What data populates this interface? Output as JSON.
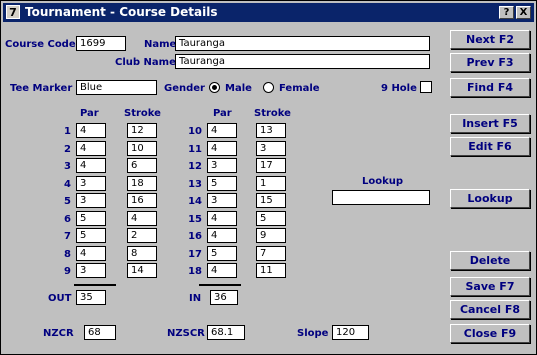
{
  "window": {
    "title": "Tournament - Course Details",
    "icon_glyph": "7",
    "help_glyph": "?",
    "close_glyph": "X"
  },
  "course": {
    "code_label": "Course Code",
    "code": "1699",
    "name_label": "Name",
    "name": "Tauranga",
    "club_label": "Club Name",
    "club": "Tauranga",
    "tee_label": "Tee Marker",
    "tee": "Blue",
    "gender_label": "Gender",
    "male_label": "Male",
    "female_label": "Female",
    "gender_selected": "Male",
    "nine_hole_label": "9 Hole",
    "nine_hole_checked": false
  },
  "holes": {
    "par_header": "Par",
    "stroke_header": "Stroke",
    "front": [
      {
        "n": "1",
        "par": "4",
        "stroke": "12"
      },
      {
        "n": "2",
        "par": "4",
        "stroke": "10"
      },
      {
        "n": "3",
        "par": "4",
        "stroke": "6"
      },
      {
        "n": "4",
        "par": "3",
        "stroke": "18"
      },
      {
        "n": "5",
        "par": "3",
        "stroke": "16"
      },
      {
        "n": "6",
        "par": "5",
        "stroke": "4"
      },
      {
        "n": "7",
        "par": "5",
        "stroke": "2"
      },
      {
        "n": "8",
        "par": "4",
        "stroke": "8"
      },
      {
        "n": "9",
        "par": "3",
        "stroke": "14"
      }
    ],
    "back": [
      {
        "n": "10",
        "par": "4",
        "stroke": "13"
      },
      {
        "n": "11",
        "par": "4",
        "stroke": "3"
      },
      {
        "n": "12",
        "par": "3",
        "stroke": "17"
      },
      {
        "n": "13",
        "par": "5",
        "stroke": "1"
      },
      {
        "n": "14",
        "par": "3",
        "stroke": "15"
      },
      {
        "n": "15",
        "par": "4",
        "stroke": "5"
      },
      {
        "n": "16",
        "par": "4",
        "stroke": "9"
      },
      {
        "n": "17",
        "par": "5",
        "stroke": "7"
      },
      {
        "n": "18",
        "par": "4",
        "stroke": "11"
      }
    ],
    "out_label": "OUT",
    "out": "35",
    "in_label": "IN",
    "in": "36"
  },
  "ratings": {
    "nzcr_label": "NZCR",
    "nzcr": "68",
    "nzscr_label": "NZSCR",
    "nzscr": "68.1",
    "slope_label": "Slope",
    "slope": "120"
  },
  "lookup": {
    "label": "Lookup",
    "value": ""
  },
  "buttons": {
    "next": "Next F2",
    "prev": "Prev F3",
    "find": "Find F4",
    "insert": "Insert F5",
    "edit": "Edit F6",
    "lookup": "Lookup",
    "delete": "Delete",
    "save": "Save F7",
    "cancel": "Cancel F8",
    "close": "Close F9"
  },
  "colors": {
    "titlebar": "#0a246a",
    "label": "#00007f",
    "face": "#c0c0c0"
  }
}
